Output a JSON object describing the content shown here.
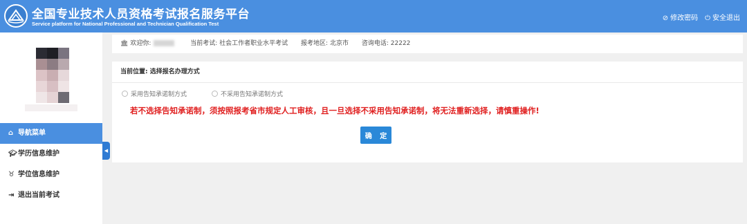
{
  "header": {
    "title_cn": "全国专业技术人员资格考试报名服务平台",
    "title_en": "Service platform for National Professional and Technician Qualification Test",
    "change_password": "修改密码",
    "logout": "安全退出"
  },
  "sidebar": {
    "items": [
      {
        "label": "导航菜单",
        "icon": "home-icon"
      },
      {
        "label": "学历信息维护",
        "icon": "graduation-cap-icon"
      },
      {
        "label": "学位信息维护",
        "icon": "degree-icon"
      },
      {
        "label": "退出当前考试",
        "icon": "exit-icon"
      }
    ]
  },
  "infobar": {
    "welcome_label": "欢迎你:",
    "exam_label": "当前考试:",
    "exam_value": "社会工作者职业水平考试",
    "region_label": "报考地区:",
    "region_value": "北京市",
    "phone_label": "咨询电话:",
    "phone_value": "22222"
  },
  "panel": {
    "location": "当前位置: 选择报名办理方式",
    "option_1": "采用告知承诺制方式",
    "option_2": "不采用告知承诺制方式",
    "warning": "若不选择告知承诺制，须按照报考省市规定人工审核，且一旦选择不采用告知承诺制，将无法重新选择，请慎重操作!",
    "confirm_label": "确 定"
  },
  "colors": {
    "header_bg": "#4a8fe0",
    "nav_active": "#4a8fe0",
    "warning": "#e02020",
    "button": "#2a88d8"
  }
}
